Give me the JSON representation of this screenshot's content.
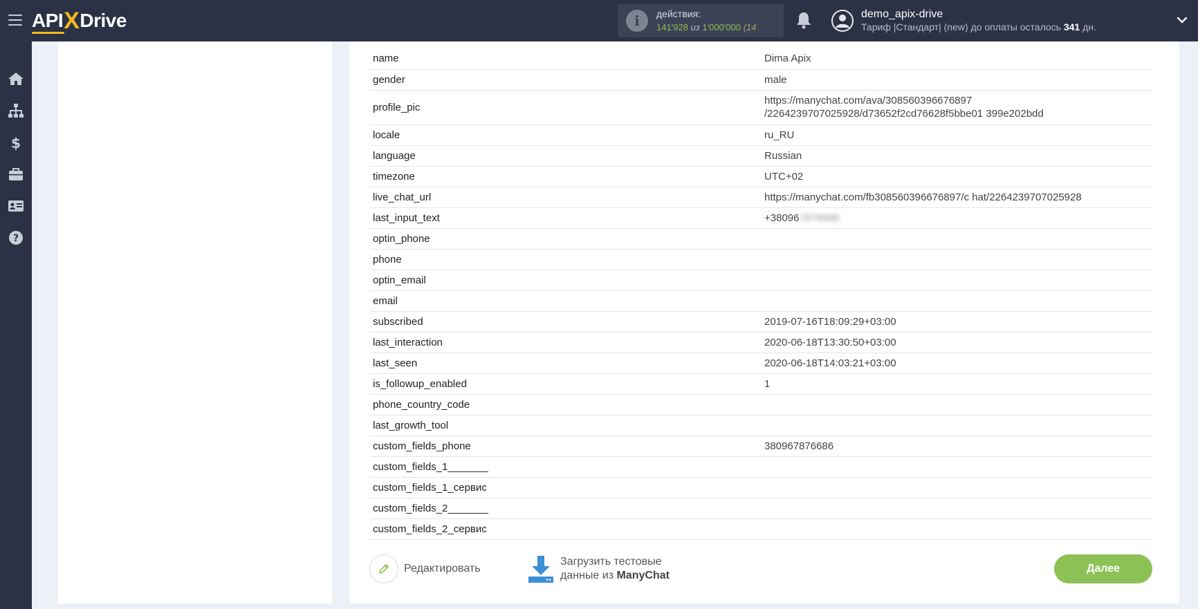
{
  "header": {
    "logo_api": "API",
    "logo_x": "X",
    "logo_drive": "Drive",
    "actions_title": "действия:",
    "actions_used": "141'928",
    "actions_sep": " из ",
    "actions_total": "1'000'000",
    "actions_extra": " (14",
    "user_name": "demo_apix-drive",
    "plan_prefix": "Тариф |Стандарт| (new) до оплаты осталось ",
    "plan_days": "341",
    "plan_suffix": " дн."
  },
  "sidebar": {
    "icons": [
      "home-icon",
      "sitemap-icon",
      "dollar-icon",
      "briefcase-icon",
      "id-card-icon",
      "help-icon"
    ]
  },
  "table": {
    "rows": [
      {
        "key": "name",
        "value": "Dima Apix"
      },
      {
        "key": "gender",
        "value": "male"
      },
      {
        "key": "profile_pic",
        "value": "https://manychat.com/ava/308560396676897\n/2264239707025928/d73652f2cd76628f5bbe01 399e202bdd"
      },
      {
        "key": "locale",
        "value": "ru_RU"
      },
      {
        "key": "language",
        "value": "Russian"
      },
      {
        "key": "timezone",
        "value": "UTC+02"
      },
      {
        "key": "live_chat_url",
        "value": "https://manychat.com/fb308560396676897/c hat/2264239707025928"
      },
      {
        "key": "last_input_text",
        "value": "+38096",
        "blurred": "7876686"
      },
      {
        "key": "optin_phone",
        "value": ""
      },
      {
        "key": "phone",
        "value": ""
      },
      {
        "key": "optin_email",
        "value": ""
      },
      {
        "key": "email",
        "value": ""
      },
      {
        "key": "subscribed",
        "value": "2019-07-16T18:09:29+03:00"
      },
      {
        "key": "last_interaction",
        "value": "2020-06-18T13:30:50+03:00"
      },
      {
        "key": "last_seen",
        "value": "2020-06-18T14:03:21+03:00"
      },
      {
        "key": "is_followup_enabled",
        "value": "1"
      },
      {
        "key": "phone_country_code",
        "value": ""
      },
      {
        "key": "last_growth_tool",
        "value": ""
      },
      {
        "key": "custom_fields_phone",
        "value": "380967876686"
      },
      {
        "key": "custom_fields_1_______",
        "value": ""
      },
      {
        "key": "custom_fields_1_сервис",
        "value": ""
      },
      {
        "key": "custom_fields_2_______",
        "value": ""
      },
      {
        "key": "custom_fields_2_сервис",
        "value": ""
      }
    ]
  },
  "buttons": {
    "edit_label": "Редактировать",
    "load_line1": "Загрузить тестовые",
    "load_line2_prefix": "данные из ",
    "load_line2_service": "ManyChat",
    "next_label": "Далее"
  },
  "colors": {
    "topbar": "#2c3245",
    "accent_green": "#8cc155",
    "logo_yellow": "#f5b91d",
    "download_blue": "#3c8fd6"
  }
}
